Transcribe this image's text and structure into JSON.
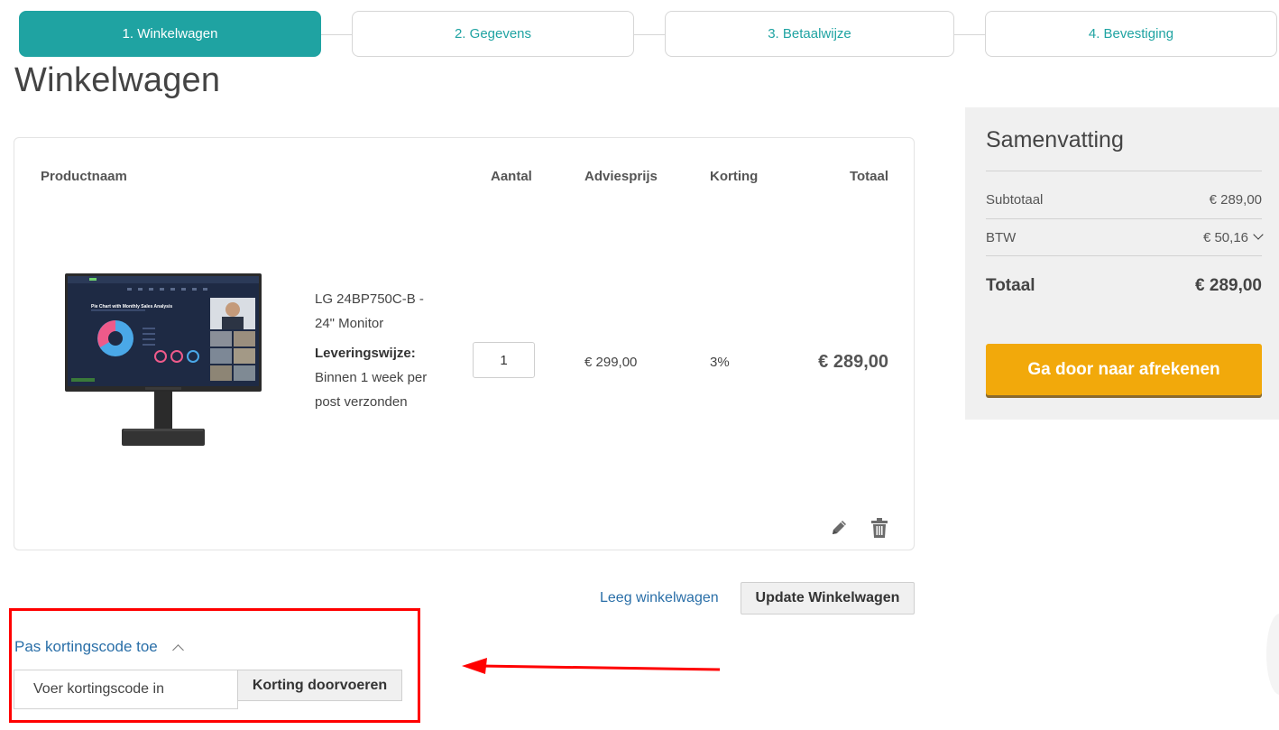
{
  "stepper": {
    "steps": [
      {
        "label": "1. Winkelwagen",
        "active": true
      },
      {
        "label": "2. Gegevens",
        "active": false
      },
      {
        "label": "3. Betaalwijze",
        "active": false
      },
      {
        "label": "4. Bevestiging",
        "active": false
      }
    ]
  },
  "page": {
    "title": "Winkelwagen"
  },
  "cart": {
    "headers": {
      "product": "Productnaam",
      "quantity": "Aantal",
      "list_price": "Adviesprijs",
      "discount": "Korting",
      "total": "Totaal"
    },
    "item": {
      "name": "LG 24BP750C-B - 24\" Monitor",
      "delivery_label": "Leveringswijze:",
      "delivery_text": "Binnen 1 week per post verzonden",
      "quantity": "1",
      "list_price": "€ 299,00",
      "discount": "3%",
      "total": "€ 289,00",
      "image_icon": "monitor-product-image",
      "edit_icon": "pencil-icon",
      "delete_icon": "trash-icon",
      "monitor_screen": {
        "chart_title": "Pie Chart with Monthly Sales Analysis"
      }
    }
  },
  "summary": {
    "title": "Samenvatting",
    "subtotal_label": "Subtotaal",
    "subtotal_value": "€ 289,00",
    "vat_label": "BTW",
    "vat_value": "€ 50,16",
    "total_label": "Totaal",
    "total_value": "€ 289,00",
    "checkout_label": "Ga door naar afrekenen"
  },
  "actions": {
    "empty_cart_label": "Leeg winkelwagen",
    "update_cart_label": "Update Winkelwagen"
  },
  "coupon": {
    "toggle_label": "Pas kortingscode toe",
    "input_placeholder": "Voer kortingscode in",
    "apply_label": "Korting doorvoeren"
  },
  "colors": {
    "brand_teal": "#1fa3a2",
    "checkout_orange": "#f2a90b",
    "link_blue": "#2a6fa8",
    "annotation_red": "#ff0000"
  }
}
